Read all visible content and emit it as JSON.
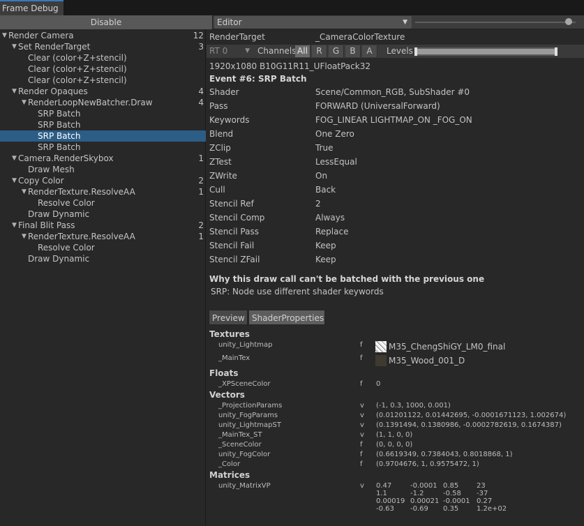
{
  "window": {
    "tab_title": "Frame Debug"
  },
  "toolbar": {
    "disable_label": "Disable",
    "target_select": "Editor"
  },
  "tree": [
    {
      "label": "Render Camera",
      "count": "12",
      "arrow": "▼",
      "indent": 0
    },
    {
      "label": "Set RenderTarget",
      "count": "3",
      "arrow": "▼",
      "indent": 1
    },
    {
      "label": "Clear (color+Z+stencil)",
      "count": "",
      "arrow": "",
      "indent": 2
    },
    {
      "label": "Clear (color+Z+stencil)",
      "count": "",
      "arrow": "",
      "indent": 2
    },
    {
      "label": "Clear (color+Z+stencil)",
      "count": "",
      "arrow": "",
      "indent": 2
    },
    {
      "label": "Render Opaques",
      "count": "4",
      "arrow": "▼",
      "indent": 1
    },
    {
      "label": "RenderLoopNewBatcher.Draw",
      "count": "4",
      "arrow": "▼",
      "indent": 2
    },
    {
      "label": "SRP Batch",
      "count": "",
      "arrow": "",
      "indent": 3
    },
    {
      "label": "SRP Batch",
      "count": "",
      "arrow": "",
      "indent": 3
    },
    {
      "label": "SRP Batch",
      "count": "",
      "arrow": "",
      "indent": 3,
      "selected": true
    },
    {
      "label": "SRP Batch",
      "count": "",
      "arrow": "",
      "indent": 3
    },
    {
      "label": "Camera.RenderSkybox",
      "count": "1",
      "arrow": "▼",
      "indent": 1
    },
    {
      "label": "Draw Mesh",
      "count": "",
      "arrow": "",
      "indent": 2
    },
    {
      "label": "Copy Color",
      "count": "2",
      "arrow": "▼",
      "indent": 1
    },
    {
      "label": "RenderTexture.ResolveAA",
      "count": "1",
      "arrow": "▼",
      "indent": 2
    },
    {
      "label": "Resolve Color",
      "count": "",
      "arrow": "",
      "indent": 3
    },
    {
      "label": "Draw Dynamic",
      "count": "",
      "arrow": "",
      "indent": 2
    },
    {
      "label": "Final Blit Pass",
      "count": "2",
      "arrow": "▼",
      "indent": 1
    },
    {
      "label": "RenderTexture.ResolveAA",
      "count": "1",
      "arrow": "▼",
      "indent": 2
    },
    {
      "label": "Resolve Color",
      "count": "",
      "arrow": "",
      "indent": 3
    },
    {
      "label": "Draw Dynamic",
      "count": "",
      "arrow": "",
      "indent": 2
    }
  ],
  "detail": {
    "render_target_label": "RenderTarget",
    "render_target_value": "_CameraColorTexture",
    "rt_select": "RT 0",
    "channels_label": "Channels",
    "channels": [
      "All",
      "R",
      "G",
      "B",
      "A"
    ],
    "levels_label": "Levels",
    "format": "1920x1080 B10G11R11_UFloatPack32",
    "event_title": "Event #6: SRP Batch",
    "props": [
      [
        "Shader",
        "Scene/Common_RGB, SubShader #0"
      ],
      [
        "Pass",
        "FORWARD (UniversalForward)"
      ],
      [
        "Keywords",
        "FOG_LINEAR LIGHTMAP_ON _FOG_ON"
      ],
      [
        "Blend",
        "One Zero"
      ],
      [
        "ZClip",
        "True"
      ],
      [
        "ZTest",
        "LessEqual"
      ],
      [
        "ZWrite",
        "On"
      ],
      [
        "Cull",
        "Back"
      ],
      [
        "Stencil Ref",
        "2"
      ],
      [
        "Stencil Comp",
        "Always"
      ],
      [
        "Stencil Pass",
        "Replace"
      ],
      [
        "Stencil Fail",
        "Keep"
      ],
      [
        "Stencil ZFail",
        "Keep"
      ]
    ],
    "batch_heading": "Why this draw call can't be batched with the previous one",
    "batch_reason": "SRP: Node use different shader keywords",
    "tabs": [
      "Preview",
      "ShaderProperties"
    ]
  },
  "shader_props": {
    "textures_heading": "Textures",
    "textures": [
      {
        "name": "unity_Lightmap",
        "type": "f",
        "value": "M35_ChengShiGY_LM0_final"
      },
      {
        "name": "_MainTex",
        "type": "f",
        "value": "M35_Wood_001_D"
      }
    ],
    "floats_heading": "Floats",
    "floats": [
      {
        "name": "_XPSceneColor",
        "type": "f",
        "value": "0"
      }
    ],
    "vectors_heading": "Vectors",
    "vectors": [
      {
        "name": "_ProjectionParams",
        "type": "v",
        "value": "(-1, 0.3, 1000, 0.001)"
      },
      {
        "name": "unity_FogParams",
        "type": "v",
        "value": "(0.01201122, 0.01442695, -0.0001671123, 1.002674)"
      },
      {
        "name": "unity_LightmapST",
        "type": "v",
        "value": "(0.1391494, 0.1380986, -0.0002782619, 0.1674387)"
      },
      {
        "name": "_MainTex_ST",
        "type": "v",
        "value": "(1, 1, 0, 0)"
      },
      {
        "name": "_SceneColor",
        "type": "f",
        "value": "(0, 0, 0, 0)"
      },
      {
        "name": "unity_FogColor",
        "type": "f",
        "value": "(0.6619349, 0.7384043, 0.8018868, 1)"
      },
      {
        "name": "_Color",
        "type": "f",
        "value": "(0.9704676, 1, 0.9575472, 1)"
      }
    ],
    "matrices_heading": "Matrices",
    "matrix": {
      "name": "unity_MatrixVP",
      "type": "v",
      "rows": [
        [
          "0.47",
          "-0.0001",
          "0.85",
          "23"
        ],
        [
          "1.1",
          "-1.2",
          "-0.58",
          "-37"
        ],
        [
          "0.00019",
          "0.00021",
          "-0.0001",
          "0.27"
        ],
        [
          "-0.63",
          "-0.69",
          "0.35",
          "1.2e+02"
        ]
      ]
    }
  }
}
